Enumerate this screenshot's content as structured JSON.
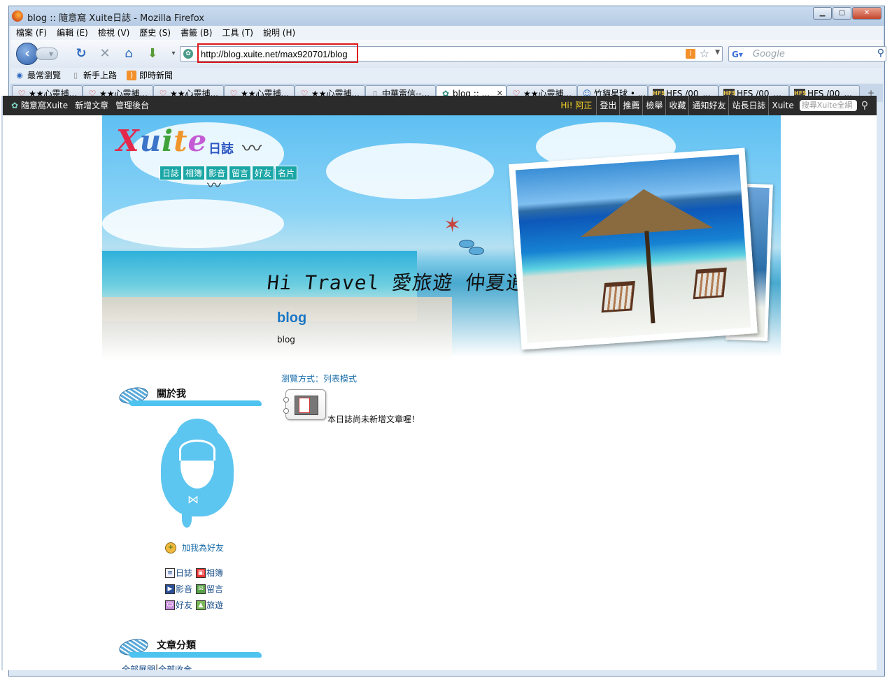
{
  "window": {
    "title": "blog :: 隨意窩 Xuite日誌 - Mozilla Firefox",
    "controls": {
      "minimize": "0",
      "maximize": "1",
      "close": "r"
    }
  },
  "menu": [
    "檔案 (F)",
    "編輯 (E)",
    "檢視 (V)",
    "歷史 (S)",
    "書籤 (B)",
    "工具 (T)",
    "說明 (H)"
  ],
  "address": {
    "url": "http://blog.xuite.net/max920701/blog",
    "highlighted": true,
    "highlight_color": "#e0161a"
  },
  "search": {
    "placeholder": "Google",
    "engine_icon": "google-icon"
  },
  "bookmarks": [
    {
      "label": "最常瀏覽",
      "icon": "most-visited-icon"
    },
    {
      "label": "新手上路",
      "icon": "page-icon"
    },
    {
      "label": "即時新聞",
      "icon": "rss-icon"
    }
  ],
  "tabs": [
    {
      "label": "★★心靈捕...",
      "icon": "heart",
      "active": false
    },
    {
      "label": "★★心靈捕...",
      "icon": "heart",
      "active": false
    },
    {
      "label": "★★心靈捕...",
      "icon": "heart",
      "active": false
    },
    {
      "label": "★★心靈捕...",
      "icon": "heart",
      "active": false
    },
    {
      "label": "★★心靈捕...",
      "icon": "heart",
      "active": false
    },
    {
      "label": "中華電信--...",
      "icon": "page",
      "active": false
    },
    {
      "label": "blog :: ...",
      "icon": "xuite",
      "active": true
    },
    {
      "label": "★★心靈捕...",
      "icon": "heart",
      "active": false
    },
    {
      "label": "竹貓星球 • ...",
      "icon": "cat",
      "active": false
    },
    {
      "label": "HFS /00_...",
      "icon": "hfs",
      "active": false
    },
    {
      "label": "HFS /00_...",
      "icon": "hfs",
      "active": false
    },
    {
      "label": "HFS /00_...",
      "icon": "hfs",
      "active": false
    }
  ],
  "xuite_bar": {
    "left": [
      "隨意窩Xuite",
      "新增文章",
      "管理後台"
    ],
    "greeting": "Hi! 阿正",
    "right": [
      "登出",
      "推薦",
      "檢舉",
      "收藏",
      "通知好友",
      "站長日誌",
      "Xuite"
    ],
    "search_placeholder": "搜尋Xuite全網",
    "accent": "#f4d025"
  },
  "banner": {
    "logo": {
      "x": "X",
      "u": "u",
      "i": "i",
      "t": "t",
      "e": "e"
    },
    "logo_sub": "日誌",
    "nav": [
      "日誌",
      "相簿",
      "影音",
      "留言",
      "好友",
      "名片"
    ],
    "slogan": "Hi Travel 愛旅遊 仲夏逍遙遊",
    "blog_title": "blog",
    "blog_subtitle": "blog"
  },
  "sidebar": {
    "about_title": "關於我",
    "add_friend": "加我為好友",
    "links": [
      {
        "label": "日誌",
        "icon": "journal-icon"
      },
      {
        "label": "相簿",
        "icon": "album-icon"
      },
      {
        "label": "影音",
        "icon": "video-icon"
      },
      {
        "label": "留言",
        "icon": "message-icon"
      },
      {
        "label": "好友",
        "icon": "friends-icon"
      },
      {
        "label": "旅遊",
        "icon": "travel-icon"
      }
    ],
    "category_title": "文章分類",
    "expand_all": "全部展開",
    "collapse_all": "全部收合"
  },
  "main": {
    "browse_mode": "瀏覽方式：列表模式",
    "empty_message": "本日誌尚未新增文章喔！"
  }
}
